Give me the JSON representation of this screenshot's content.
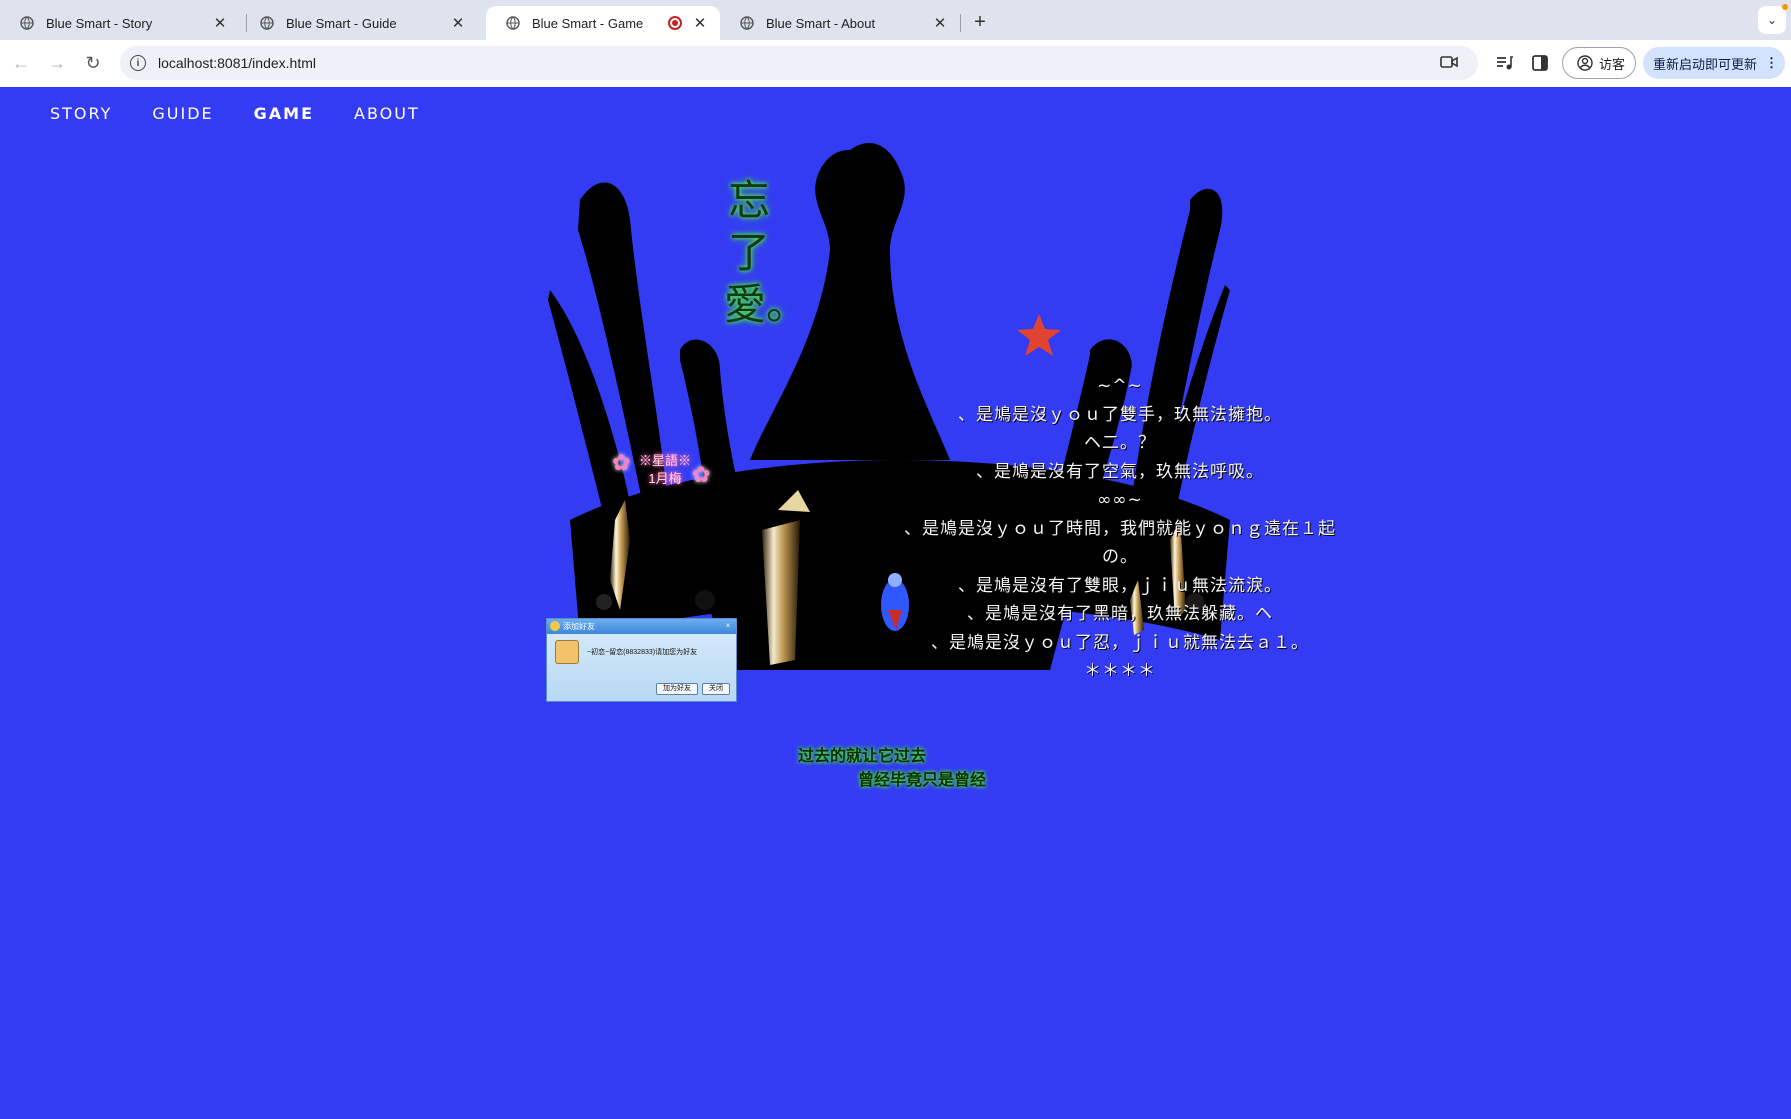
{
  "browser": {
    "tabs": [
      {
        "title": "Blue Smart - Story",
        "active": false
      },
      {
        "title": "Blue Smart - Guide",
        "active": false
      },
      {
        "title": "Blue Smart - Game",
        "active": true,
        "recording": true
      },
      {
        "title": "Blue Smart - About",
        "active": false
      }
    ],
    "close_glyph": "✕",
    "new_tab_glyph": "+",
    "tab_menu_glyph": "⌄",
    "address": "localhost:8081/index.html",
    "profile_label": "访客",
    "update_label": "重新启动即可更新",
    "update_menu_glyph": "⋮",
    "nav": {
      "back_glyph": "←",
      "forward_glyph": "→",
      "reload_glyph": "↻"
    }
  },
  "site_nav": [
    {
      "label": "STORY",
      "active": false
    },
    {
      "label": "GUIDE",
      "active": false
    },
    {
      "label": "GAME",
      "active": true
    },
    {
      "label": "ABOUT",
      "active": false
    }
  ],
  "decor": {
    "glitter_title": "忘了愛。",
    "flower_name_line1": "※星語※",
    "flower_name_line2": "1月梅",
    "bottom_caption_line1": "过去的就让它过去",
    "bottom_caption_line2": "曾经毕竟只是曾经"
  },
  "poem": [
    "~^~",
    "、是鳩是沒ｙｏｕ了雙手，玖無法擁抱。",
    "ヘ二。？",
    "、是鳩是沒有了空氣，玖無法呼吸。",
    "∞∞~",
    "、是鳩是沒ｙｏｕ了時間，我們就能ｙｏｎｇ遠在１起",
    "の。",
    "、是鳩是沒有了雙眼，ｊｉｕ無法流淚。",
    "、是鳩是沒有了黑暗，玖無法躲藏。ヘ",
    "、是鳩是沒ｙｏｕ了忍，ｊｉｕ就無法去ａ１。",
    "＊＊＊＊"
  ],
  "dialog": {
    "title": "添加好友",
    "message": "~初恋~留恋(8832833)请加您为好友",
    "accept_label": "加为好友",
    "close_label": "关闭"
  },
  "colors": {
    "page_background": "#343cf3",
    "crown": "#000000",
    "star": "#e0432f",
    "glitter_green": "#2bd42b",
    "glitter_pink": "#ff4fa3"
  }
}
